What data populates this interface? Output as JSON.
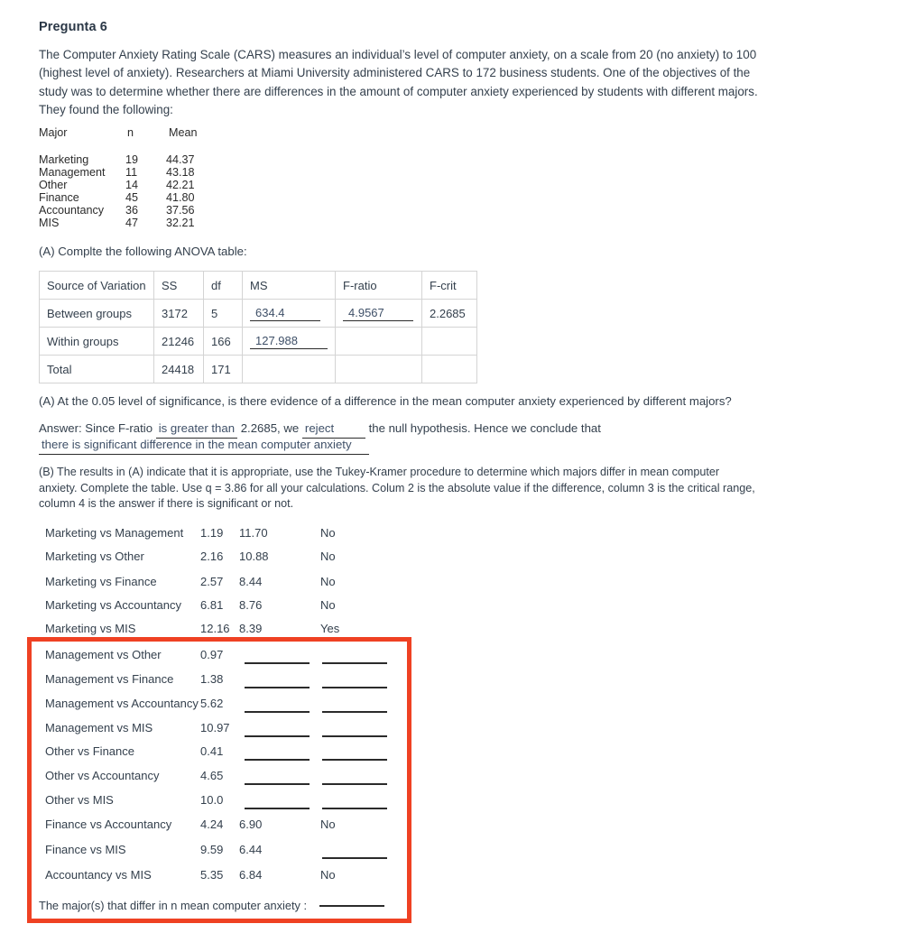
{
  "question": {
    "title": "Pregunta 6",
    "intro": "The Computer Anxiety Rating Scale (CARS) measures an individual’s level of computer anxiety, on a scale from 20 (no anxiety) to 100 (highest level of anxiety). Researchers at Miami University administered CARS to 172 business students. One of the objectives of the study was to determine whether there are differences in the amount of computer anxiety experienced by students with different majors. They found the following:"
  },
  "major_table": {
    "headers": [
      "Major",
      "n",
      "Mean"
    ],
    "rows": [
      {
        "major": "Marketing",
        "n": "19",
        "mean": "44.37"
      },
      {
        "major": "Management",
        "n": "11",
        "mean": "43.18"
      },
      {
        "major": "Other",
        "n": "14",
        "mean": "42.21"
      },
      {
        "major": "Finance",
        "n": "45",
        "mean": "41.80"
      },
      {
        "major": "Accountancy",
        "n": "36",
        "mean": "37.56"
      },
      {
        "major": "MIS",
        "n": "47",
        "mean": "32.21"
      }
    ]
  },
  "part_a": {
    "prompt": "(A) Complte the following ANOVA table:",
    "anova": {
      "headers": [
        "Source of Variation",
        "SS",
        "df",
        "MS",
        "F-ratio",
        "F-crit"
      ],
      "rows": [
        {
          "source": "Between groups",
          "ss": "3172",
          "df": "5",
          "ms": "634.4",
          "fratio": "4.9567",
          "fcrit": "2.2685"
        },
        {
          "source": "Within groups",
          "ss": "21246",
          "df": "166",
          "ms": "127.988",
          "fratio": "",
          "fcrit": ""
        },
        {
          "source": "Total",
          "ss": "24418",
          "df": "171",
          "ms": "",
          "fratio": "",
          "fcrit": ""
        }
      ]
    },
    "question": "(A)  At the 0.05 level of significance, is there evidence of a difference in the mean computer anxiety experienced by different majors?",
    "answer_prefix": "Answer: Since F-ratio",
    "answer_blank1": "is greater than",
    "answer_mid": "2.2685, we",
    "answer_blank2": "reject",
    "answer_suffix": "the null hypothesis. Hence we conclude that",
    "answer_blank3": "there is significant difference in the mean computer anxiety"
  },
  "part_b": {
    "prompt": "(B) The results in (A) indicate that it is appropriate, use the Tukey-Kramer procedure to determine which majors differ in mean computer anxiety. Complete the table. Use q = 3.86 for all your calculations. Colum 2 is the absolute value if the difference, column 3 is the critical range, column 4 is the answer if there is significant or not.",
    "comparisons": [
      {
        "pair": "Marketing vs Management",
        "diff": "1.19",
        "range": "11.70",
        "significant": "No"
      },
      {
        "pair": "Marketing vs Other",
        "diff": "2.16",
        "range": "10.88",
        "significant": "No"
      },
      {
        "pair": "Marketing vs Finance",
        "diff": "2.57",
        "range": "8.44",
        "significant": "No"
      },
      {
        "pair": "Marketing vs Accountancy",
        "diff": "6.81",
        "range": "8.76",
        "significant": "No"
      },
      {
        "pair": "Marketing vs MIS",
        "diff": "12.16",
        "range": "8.39",
        "significant": "Yes"
      },
      {
        "pair": "Management vs Other",
        "diff": "0.97",
        "range": "",
        "significant": ""
      },
      {
        "pair": "Management vs Finance",
        "diff": "1.38",
        "range": "",
        "significant": ""
      },
      {
        "pair": "Management vs Accountancy",
        "diff": "5.62",
        "range": "",
        "significant": ""
      },
      {
        "pair": "Management vs MIS",
        "diff": "10.97",
        "range": "",
        "significant": ""
      },
      {
        "pair": "Other vs Finance",
        "diff": "0.41",
        "range": "",
        "significant": ""
      },
      {
        "pair": "Other vs Accountancy",
        "diff": "4.65",
        "range": "",
        "significant": ""
      },
      {
        "pair": "Other vs MIS",
        "diff": "10.0",
        "range": "",
        "significant": ""
      },
      {
        "pair": "Finance vs Accountancy",
        "diff": "4.24",
        "range": "6.90",
        "significant": "No"
      },
      {
        "pair": "Finance vs MIS",
        "diff": "9.59",
        "range": "6.44",
        "significant": ""
      },
      {
        "pair": "Accountancy vs MIS",
        "diff": "5.35",
        "range": "6.84",
        "significant": "No"
      }
    ],
    "final_prompt": "The major(s) that differ in n mean computer anxiety :"
  },
  "colors": {
    "highlight_box": "#ef4123",
    "fill_text": "#3f5068",
    "body_text": "#34404d",
    "table_border": "#d4d4d4"
  }
}
